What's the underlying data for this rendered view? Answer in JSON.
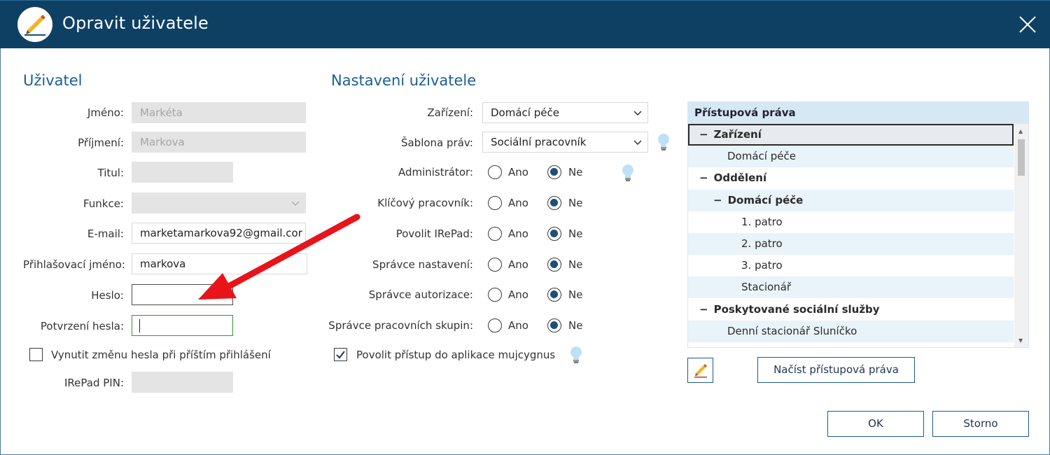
{
  "window": {
    "title": "Opravit uživatele",
    "icon": "pencil-icon",
    "close_icon": "close-icon"
  },
  "user_section": {
    "title": "Uživatel",
    "fields": {
      "first_name": {
        "label": "Jméno:",
        "value": "Markéta",
        "disabled": true
      },
      "last_name": {
        "label": "Příjmení:",
        "value": "Markova",
        "disabled": true
      },
      "title": {
        "label": "Titul:",
        "value": "",
        "disabled": true
      },
      "function": {
        "label": "Funkce:",
        "value": "",
        "disabled": true
      },
      "email": {
        "label": "E-mail:",
        "value": "marketamarkova92@gmail.cor"
      },
      "login": {
        "label": "Přihlašovací jméno:",
        "value": "markova"
      },
      "password": {
        "label": "Heslo:",
        "value": ""
      },
      "password_confirm": {
        "label": "Potvrzení hesla:",
        "value": ""
      },
      "irepad_pin": {
        "label": "IRePad PIN:",
        "value": "",
        "disabled": true
      }
    },
    "force_password_change": {
      "label": "Vynutit změnu hesla při příštím přihlášení",
      "checked": false
    }
  },
  "settings_section": {
    "title": "Nastavení uživatele",
    "facility": {
      "label": "Zařízení:",
      "value": "Domácí péče"
    },
    "rights_template": {
      "label": "Šablona práv:",
      "value": "Sociální pracovník"
    },
    "yes_label": "Ano",
    "no_label": "Ne",
    "radios": [
      {
        "label": "Administrátor:",
        "value": "Ne"
      },
      {
        "label": "Klíčový pracovník:",
        "value": "Ne"
      },
      {
        "label": "Povolit IRePad:",
        "value": "Ne"
      },
      {
        "label": "Správce nastavení:",
        "value": "Ne"
      },
      {
        "label": "Správce autorizace:",
        "value": "Ne"
      },
      {
        "label": "Správce pracovních skupin:",
        "value": "Ne"
      }
    ],
    "allow_app_access": {
      "label": "Povolit přístup do aplikace mujcygnus",
      "checked": true
    }
  },
  "access_rights": {
    "header": "Přístupová práva",
    "rows": [
      {
        "prefix": "−",
        "text": "Zařízení"
      },
      {
        "prefix": "",
        "text": "Domácí péče"
      },
      {
        "prefix": "−",
        "text": "Oddělení"
      },
      {
        "prefix": "−",
        "text": "Domácí péče"
      },
      {
        "prefix": "",
        "text": "1. patro"
      },
      {
        "prefix": "",
        "text": "2. patro"
      },
      {
        "prefix": "",
        "text": "3. patro"
      },
      {
        "prefix": "",
        "text": "Stacionář"
      },
      {
        "prefix": "−",
        "text": "Poskytované sociální služby"
      },
      {
        "prefix": "",
        "text": "Denní stacionář Sluníčko"
      }
    ],
    "load_button": "Načíst přístupová práva"
  },
  "footer": {
    "ok": "OK",
    "cancel": "Storno"
  },
  "colors": {
    "titlebar": "#0e4064",
    "accent": "#1a5f95",
    "annotation_arrow": "#e8141a"
  }
}
